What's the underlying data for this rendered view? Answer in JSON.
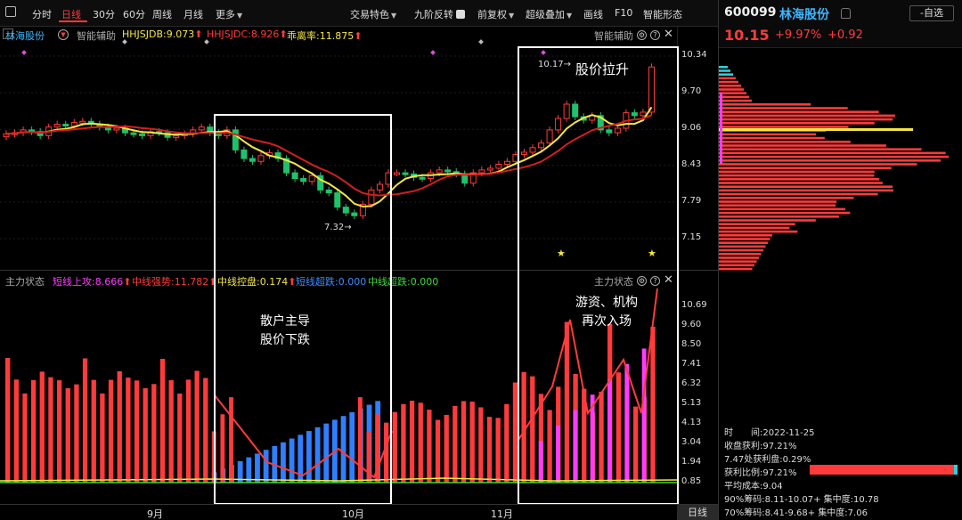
{
  "toolbar": {
    "left_items": [
      "分时",
      "日线",
      "30分",
      "60分",
      "周线",
      "月线",
      "更多"
    ],
    "active_item": "日线",
    "right_items": [
      "交易特色",
      "九阶反转",
      "前复权",
      "超级叠加",
      "画线",
      "F10",
      "智能形态"
    ]
  },
  "price_panel": {
    "stock_label": "林海股份",
    "assist_label": "智能辅助",
    "legend": [
      {
        "text": "HHJSJDB:9.073",
        "color": "#f5e642"
      },
      {
        "text": "HHJSJDC:8.926",
        "color": "#ff3b3b"
      },
      {
        "text": "乖离率:11.875",
        "color": "#f5e642"
      }
    ],
    "right_label": "智能辅助",
    "y_ticks": [
      "10.34",
      "9.70",
      "9.06",
      "8.43",
      "7.79",
      "7.15"
    ],
    "low_annotation": "7.32",
    "high_annotation": "10.17",
    "box_left_label": "",
    "box_right_label": "股价拉升"
  },
  "indicator_panel": {
    "title": "主力状态",
    "legend": [
      {
        "text": "短线上攻:8.666",
        "color": "#ff3bff"
      },
      {
        "text": "中线强势:11.782",
        "color": "#ff3b3b"
      },
      {
        "text": "中线控盘:0.174",
        "color": "#f5e642"
      },
      {
        "text": "短线超跌:0.000",
        "color": "#3d8bff"
      },
      {
        "text": "中线超跌:0.000",
        "color": "#3bd93b"
      }
    ],
    "right_label": "主力状态",
    "y_ticks": [
      "10.69",
      "9.60",
      "8.50",
      "7.41",
      "6.32",
      "5.13",
      "4.13",
      "3.04",
      "1.94",
      "0.85"
    ],
    "box_left_label_1": "散户主导",
    "box_left_label_2": "股价下跌",
    "box_right_label_1": "游资、机构",
    "box_right_label_2": "再次入场"
  },
  "x_axis": {
    "labels": [
      "9月",
      "10月",
      "11月"
    ],
    "period": "日线"
  },
  "sidebar": {
    "code": "600099",
    "name": "林海股份",
    "price": "10.15",
    "pct": "+9.97%",
    "change": "+0.92",
    "watch_label": "-自选",
    "info": {
      "time": "时　　间:2022-11-25",
      "profit_ratio": "收盘获利:97.21%",
      "profit_at": "7.47处获利盘:0.29%",
      "win_ratio": "获利比例:97.21%",
      "avg_cost": "平均成本:9.04",
      "chip90": "90%筹码:8.11-10.07+ 集中度:10.78",
      "chip70": "70%筹码:8.41-9.68+ 集中度:7.06"
    }
  },
  "colors": {
    "up": "#ff3b3b",
    "down": "#1fc26b",
    "ma_short": "#f5e642",
    "ma_long": "#d21f1f",
    "blue": "#2f7fff",
    "magenta": "#ff3bff",
    "cyan": "#2ecfd9"
  }
}
